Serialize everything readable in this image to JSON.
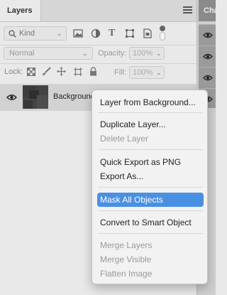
{
  "tabs": {
    "layers": "Layers",
    "right_dock_tab": "Cha"
  },
  "filter": {
    "kind_value": "Kind"
  },
  "blend": {
    "mode_value": "Normal",
    "opacity_label": "Opacity:",
    "opacity_value": "100%"
  },
  "lock": {
    "label": "Lock:",
    "fill_label": "Fill:",
    "fill_value": "100%"
  },
  "layer": {
    "name": "Background"
  },
  "menu": {
    "items": [
      {
        "label": "Layer from Background...",
        "disabled": false
      },
      {
        "label": "Duplicate Layer...",
        "disabled": false
      },
      {
        "label": "Delete Layer",
        "disabled": true
      },
      {
        "label": "Quick Export as PNG",
        "disabled": false
      },
      {
        "label": "Export As...",
        "disabled": false
      },
      {
        "label": "Mask All Objects",
        "disabled": false,
        "highlighted": true
      },
      {
        "label": "Convert to Smart Object",
        "disabled": false
      },
      {
        "label": "Merge Layers",
        "disabled": true
      },
      {
        "label": "Merge Visible",
        "disabled": true
      },
      {
        "label": "Flatten Image",
        "disabled": true
      }
    ]
  },
  "colors": {
    "highlight": "#4a90e2",
    "menu_bg": "#f2f2f2",
    "panel_bg": "#e9e9e9"
  },
  "icons": [
    "panel-menu-icon",
    "search-icon",
    "image-filter-icon",
    "adjustment-filter-icon",
    "type-filter-icon",
    "shape-filter-icon",
    "smart-object-filter-icon",
    "filter-toggle-icon",
    "lock-transparent-icon",
    "lock-brush-icon",
    "lock-position-icon",
    "lock-artboard-icon",
    "lock-all-icon",
    "eye-icon"
  ]
}
